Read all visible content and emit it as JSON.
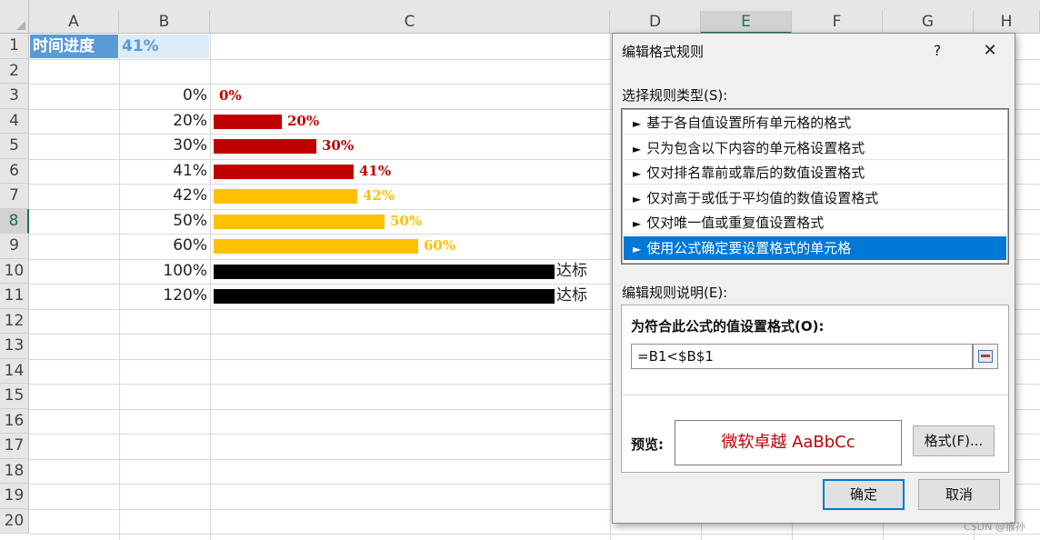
{
  "sheet": {
    "columns": [
      "A",
      "B",
      "C",
      "D",
      "E",
      "F",
      "G",
      "H"
    ],
    "rows": [
      "1",
      "2",
      "3",
      "4",
      "5",
      "6",
      "7",
      "8",
      "9",
      "10",
      "11",
      "12",
      "13",
      "14",
      "15",
      "16",
      "17",
      "18",
      "19",
      "20"
    ],
    "a1": "时间进度",
    "b1": "41%",
    "data_rows": [
      {
        "row": "3",
        "label": "0%",
        "bar_label": "0%",
        "progress": 0.0
      },
      {
        "row": "4",
        "label": "20%",
        "bar_label": "20%",
        "progress": 0.2
      },
      {
        "row": "5",
        "label": "30%",
        "bar_label": "30%",
        "progress": 0.3
      },
      {
        "row": "6",
        "label": "41%",
        "bar_label": "41%",
        "progress": 0.41
      },
      {
        "row": "7",
        "label": "42%",
        "bar_label": "42%",
        "progress": 0.42
      },
      {
        "row": "8",
        "label": "50%",
        "bar_label": "50%",
        "progress": 0.5
      },
      {
        "row": "9",
        "label": "60%",
        "bar_label": "60%",
        "progress": 0.6
      },
      {
        "row": "10",
        "label": "100%",
        "bar_label": "达标",
        "progress": 1.0
      },
      {
        "row": "11",
        "label": "120%",
        "bar_label": "达标",
        "progress": 1.0
      }
    ],
    "colors": {
      "below": "#c00000",
      "above": "#ffc000",
      "reached": "#000000",
      "header_blue": "#5b9bd5",
      "header_light": "#ddebf7"
    }
  },
  "dialog": {
    "title": "编辑格式规则",
    "help": "?",
    "close": "✕",
    "select_type_label": "选择规则类型(S):",
    "rule_types": [
      "基于各自值设置所有单元格的格式",
      "只为包含以下内容的单元格设置格式",
      "仅对排名靠前或靠后的数值设置格式",
      "仅对高于或低于平均值的数值设置格式",
      "仅对唯一值或重复值设置格式",
      "使用公式确定要设置格式的单元格"
    ],
    "selected_rule_index": 5,
    "arrow": "►",
    "edit_desc_label": "编辑规则说明(E):",
    "formula_heading": "为符合此公式的值设置格式(O):",
    "formula_value": "=B1<$B$1",
    "preview_label": "预览:",
    "preview_text": "微软卓越  AaBbCc",
    "format_button": "格式(F)...",
    "ok_button": "确定",
    "cancel_button": "取消"
  },
  "watermark": "CSDN @猴孙"
}
